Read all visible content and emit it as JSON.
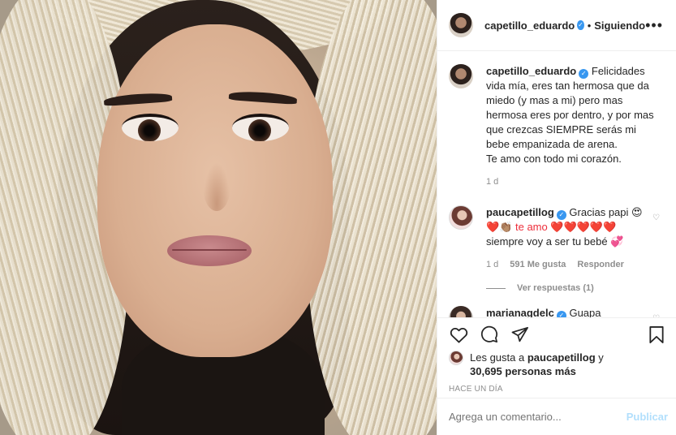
{
  "header": {
    "username": "capetillo_eduardo",
    "separator": "•",
    "follow_status": "Siguiendo",
    "more": "•••"
  },
  "caption": {
    "username": "capetillo_eduardo",
    "text": "Felicidades vida mía, eres tan hermosa que da miedo (y mas a mi) pero mas hermosa eres por dentro, y por mas que crezcas SIEMPRE serás mi bebe empanizada de arena.\nTe amo con todo mi corazón.",
    "age": "1 d"
  },
  "comments": [
    {
      "username": "paucapetillog",
      "text_a": "Gracias papi 😍",
      "text_b": "❤️👏🏽 te amo ❤️❤️❤️❤️❤️",
      "text_c": "siempre voy a ser tu bebé 💞",
      "age": "1 d",
      "likes": "591 Me gusta",
      "reply": "Responder",
      "view_replies": "Ver respuestas (1)"
    },
    {
      "username": "marianagdelc",
      "text": "Guapa"
    }
  ],
  "likes": {
    "prefix": "Les gusta a",
    "user": "paucapetillog",
    "and": "y",
    "count": "30,695 personas más"
  },
  "timestamp": "HACE UN DÍA",
  "add_comment": {
    "placeholder": "Agrega un comentario...",
    "publish": "Publicar"
  },
  "icons": [
    "heart-icon",
    "comment-icon",
    "share-icon",
    "bookmark-icon",
    "verified-icon",
    "more-icon"
  ]
}
